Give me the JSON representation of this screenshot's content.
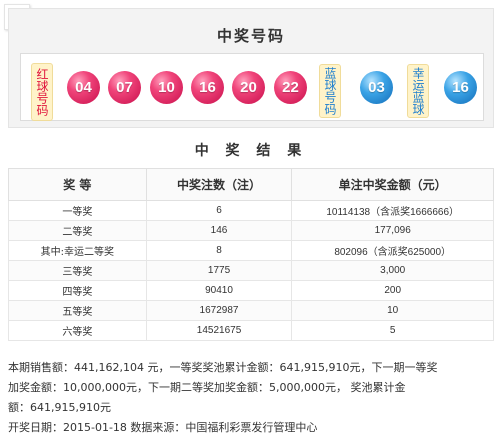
{
  "numbers_panel": {
    "title": "中奖号码",
    "red_label": "红球号码",
    "red_balls": [
      "04",
      "07",
      "10",
      "16",
      "20",
      "22"
    ],
    "blue_label": "蓝球号码",
    "blue_balls": [
      "03"
    ],
    "lucky_blue_label": "幸运蓝球",
    "lucky_blue_balls": [
      "16"
    ],
    "colors": {
      "red_ball": "#e0245e",
      "blue_ball": "#2a8ad8",
      "tag_bg": "#fff3c9"
    }
  },
  "results": {
    "title": "中 奖 结 果",
    "headers": [
      "奖 等",
      "中奖注数（注）",
      "单注中奖金额（元）"
    ],
    "rows": [
      {
        "level": "一等奖",
        "count": "6",
        "amount": "10114138（含派奖1666666）"
      },
      {
        "level": "二等奖",
        "count": "146",
        "amount": "177,096"
      },
      {
        "level": "其中:幸运二等奖",
        "count": "8",
        "amount": "802096（含派奖625000）"
      },
      {
        "level": "三等奖",
        "count": "1775",
        "amount": "3,000"
      },
      {
        "level": "四等奖",
        "count": "90410",
        "amount": "200"
      },
      {
        "level": "五等奖",
        "count": "1672987",
        "amount": "10"
      },
      {
        "level": "六等奖",
        "count": "14521675",
        "amount": "5"
      }
    ]
  },
  "footer": {
    "line1": "本期销售额：441,162,104 元，一等奖奖池累计金额：641,915,910元，下一期一等奖",
    "line2": "加奖金额：10,000,000元，下一期二等奖加奖金额：5,000,000元， 奖池累计金",
    "line3": "额：641,915,910元",
    "line4": "开奖日期：2015-01-18  数据来源：中国福利彩票发行管理中心"
  }
}
